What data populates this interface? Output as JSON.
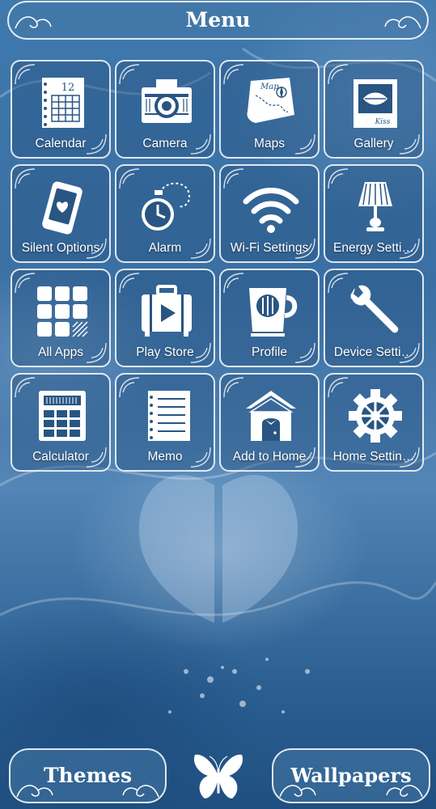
{
  "header": {
    "title": "Menu"
  },
  "apps": [
    {
      "label": "Calendar",
      "icon": "calendar-icon",
      "calendar_number": "12"
    },
    {
      "label": "Camera",
      "icon": "camera-icon"
    },
    {
      "label": "Maps",
      "icon": "map-icon",
      "map_text": "Map"
    },
    {
      "label": "Gallery",
      "icon": "photo-icon",
      "photo_text": "Kiss"
    },
    {
      "label": "Silent Options",
      "icon": "phone-heart-icon"
    },
    {
      "label": "Alarm",
      "icon": "alarm-clock-icon"
    },
    {
      "label": "Wi-Fi Settings",
      "icon": "wifi-icon"
    },
    {
      "label": "Energy Setti…",
      "icon": "lamp-icon"
    },
    {
      "label": "All Apps",
      "icon": "grid-icon"
    },
    {
      "label": "Play Store",
      "icon": "suitcase-play-icon"
    },
    {
      "label": "Profile",
      "icon": "coffee-cup-icon"
    },
    {
      "label": "Device Setti…",
      "icon": "wrench-icon"
    },
    {
      "label": "Calculator",
      "icon": "calculator-icon"
    },
    {
      "label": "Memo",
      "icon": "notebook-icon"
    },
    {
      "label": "Add to Home",
      "icon": "house-icon"
    },
    {
      "label": "Home Settin…",
      "icon": "gear-icon"
    }
  ],
  "footer": {
    "themes_label": "Themes",
    "wallpapers_label": "Wallpapers",
    "center_icon": "butterfly-icon"
  },
  "colors": {
    "background": "#3f79ad",
    "tile_fill": "#285582",
    "border": "#ffffff"
  }
}
